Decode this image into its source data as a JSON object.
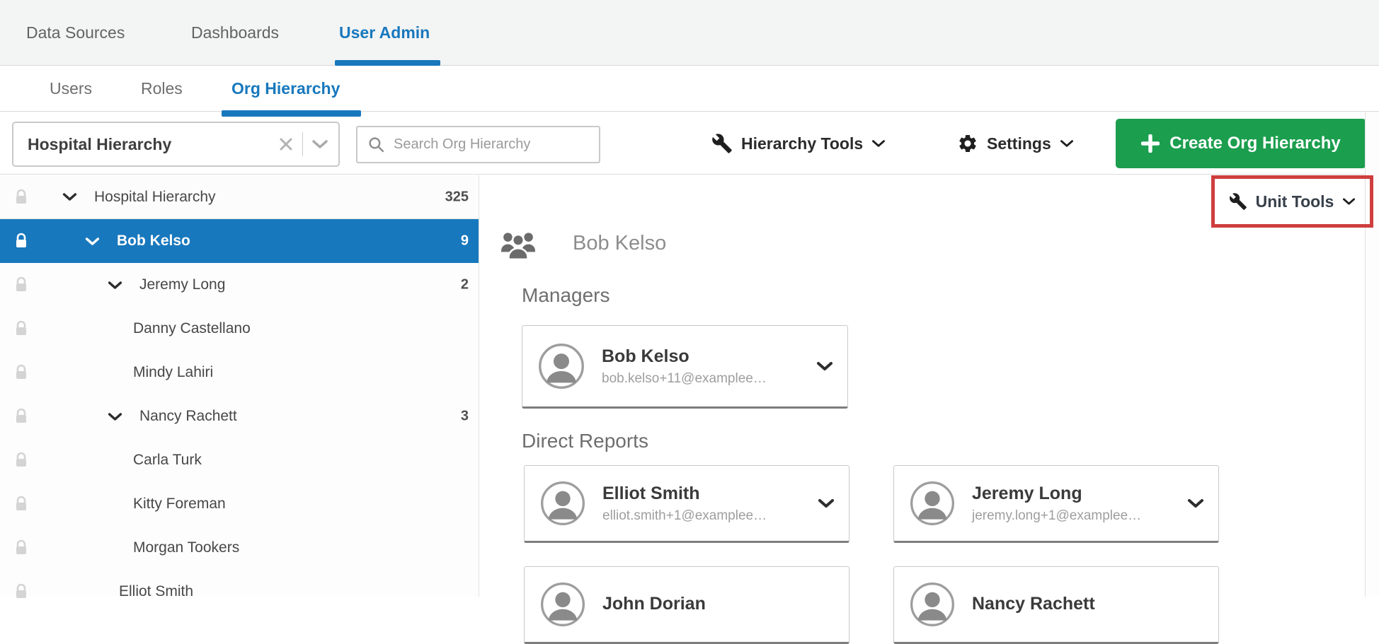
{
  "top_nav": {
    "items": [
      {
        "label": "Data Sources"
      },
      {
        "label": "Dashboards"
      },
      {
        "label": "User Admin"
      }
    ]
  },
  "sub_nav": {
    "items": [
      {
        "label": "Users"
      },
      {
        "label": "Roles"
      },
      {
        "label": "Org Hierarchy"
      }
    ]
  },
  "toolbar": {
    "hierarchy_select_value": "Hospital Hierarchy",
    "search_placeholder": "Search Org Hierarchy",
    "hierarchy_tools_label": "Hierarchy Tools",
    "settings_label": "Settings",
    "create_button_label": "Create Org Hierarchy"
  },
  "tree": {
    "items": [
      {
        "name": "Hospital Hierarchy",
        "count": "325"
      },
      {
        "name": "Bob Kelso",
        "count": "9"
      },
      {
        "name": "Jeremy Long",
        "count": "2"
      },
      {
        "name": "Danny Castellano"
      },
      {
        "name": "Mindy Lahiri"
      },
      {
        "name": "Nancy Rachett",
        "count": "3"
      },
      {
        "name": "Carla Turk"
      },
      {
        "name": "Kitty Foreman"
      },
      {
        "name": "Morgan Tookers"
      },
      {
        "name": "Elliot Smith"
      }
    ]
  },
  "detail": {
    "title": "Bob Kelso",
    "unit_tools_label": "Unit Tools",
    "managers_heading": "Managers",
    "direct_reports_heading": "Direct Reports",
    "manager_cards": [
      {
        "name": "Bob Kelso",
        "email": "bob.kelso+11@examplee…"
      }
    ],
    "direct_report_cards": [
      {
        "name": "Elliot Smith",
        "email": "elliot.smith+1@examplee…"
      },
      {
        "name": "Jeremy Long",
        "email": "jeremy.long+1@examplee…"
      },
      {
        "name": "John Dorian"
      },
      {
        "name": "Nancy Rachett"
      }
    ]
  },
  "colors": {
    "accent_blue": "#1878bd",
    "create_green": "#1b9e4e",
    "annotation_red": "#cf3e3e"
  }
}
